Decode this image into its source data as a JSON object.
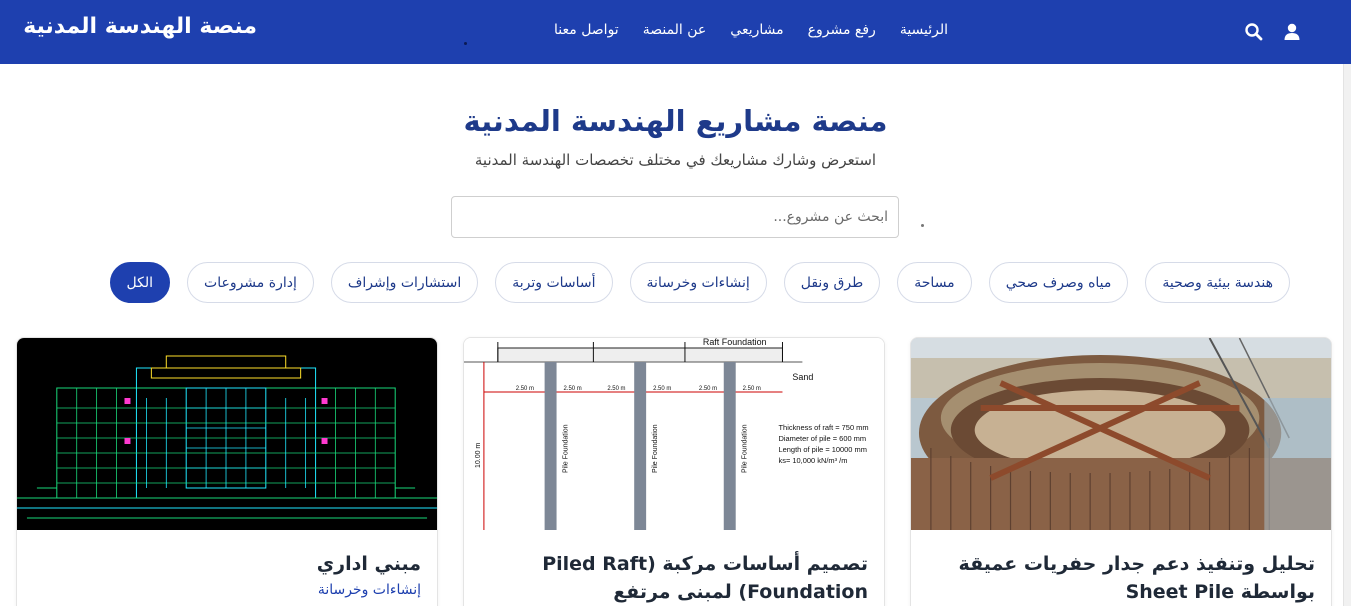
{
  "navbar": {
    "brand": "منصة الهندسة المدنية",
    "links": [
      "الرئيسية",
      "رفع مشروع",
      "مشاريعي",
      "عن المنصة",
      "تواصل معنا"
    ],
    "icons": [
      "search-icon",
      "user-icon"
    ],
    "bg_color": "#1e40af"
  },
  "hero": {
    "title": "منصة مشاريع الهندسة المدنية",
    "subtitle": "استعرض وشارك مشاريعك في مختلف تخصصات الهندسة المدنية"
  },
  "search": {
    "placeholder": "ابحث عن مشروع...",
    "value": ""
  },
  "filters": [
    {
      "label": "هندسة بيئية وصحية",
      "active": false
    },
    {
      "label": "مياه وصرف صحي",
      "active": false
    },
    {
      "label": "مساحة",
      "active": false
    },
    {
      "label": "طرق ونقل",
      "active": false
    },
    {
      "label": "إنشاءات وخرسانة",
      "active": false
    },
    {
      "label": "أساسات وتربة",
      "active": false
    },
    {
      "label": "استشارات وإشراف",
      "active": false
    },
    {
      "label": "إدارة مشروعات",
      "active": false
    },
    {
      "label": "الكل",
      "active": true
    }
  ],
  "cards": [
    {
      "title": "تحليل وتنفيذ دعم جدار حفريات عميقة بواسطة Sheet Pile",
      "category": ""
    },
    {
      "title": "تصميم أساسات مركبة (Piled Raft Foundation) لمبنى مرتفع",
      "category": "",
      "image_text": {
        "raft": "Raft Foundation",
        "sand": "Sand",
        "spacing": "2.50 m",
        "depth": "10.00 m",
        "pile": "Pile Foundation",
        "spec1": "Thickness of raft = 750 mm",
        "spec2": "Diameter of pile = 600 mm",
        "spec3": "Length of pile = 10000 mm",
        "spec4": "ks= 10,000 kN/m³ /m"
      }
    },
    {
      "title": "مبني اداري",
      "category": "إنشاءات وخرسانة"
    }
  ]
}
